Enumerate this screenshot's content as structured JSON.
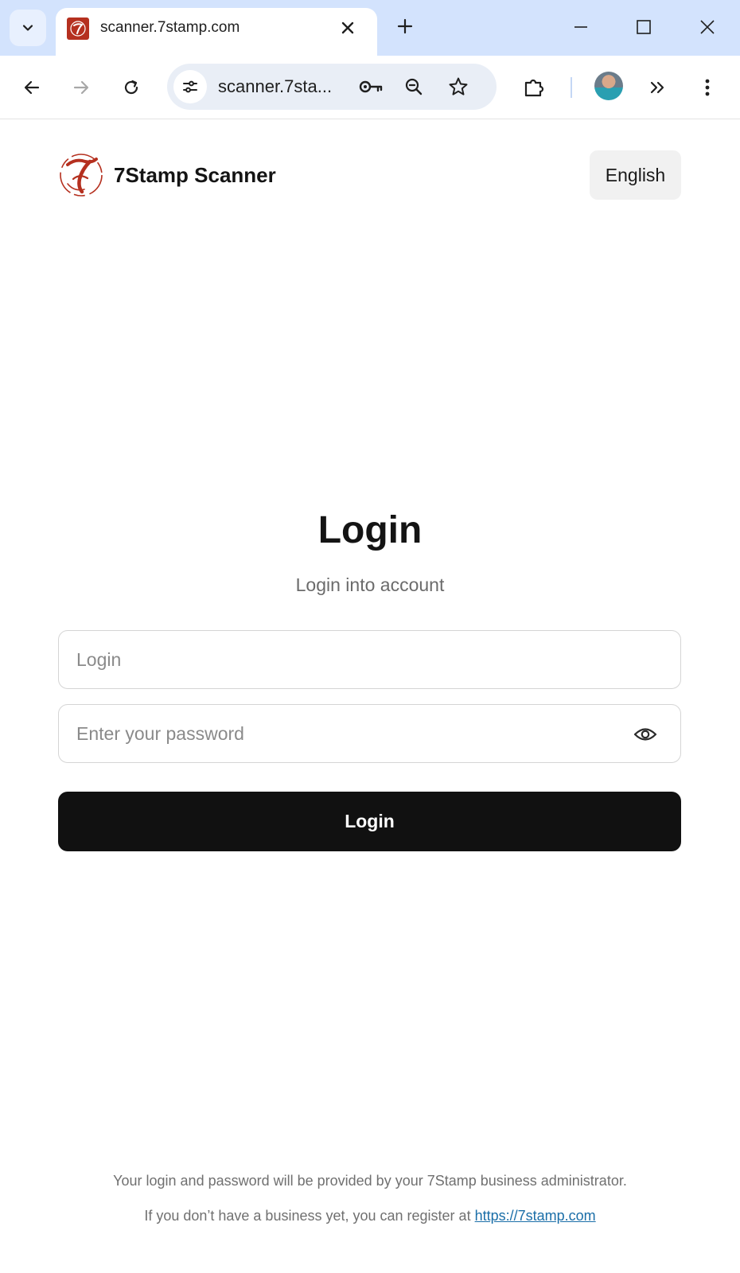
{
  "browser": {
    "tab_title": "scanner.7stamp.com",
    "address": "scanner.7sta...",
    "colors": {
      "tabbar": "#d3e3fd",
      "omnibox": "#e9eef6"
    },
    "icons": {
      "tab_search": "chevron-down-icon",
      "tab_close": "close-icon",
      "new_tab": "plus-icon",
      "minimize": "minimize-icon",
      "maximize": "maximize-icon",
      "close_window": "close-icon",
      "back": "arrow-left-icon",
      "forward": "arrow-right-icon",
      "reload": "reload-icon",
      "site_info": "tune-icon",
      "passwords": "key-icon",
      "zoom": "zoom-out-icon",
      "bookmark": "star-icon",
      "extensions": "puzzle-icon",
      "more_tools": "double-chevron-icon",
      "menu": "kebab-menu-icon"
    }
  },
  "header": {
    "brand_name": "7Stamp Scanner",
    "language_button": "English",
    "logo_color": "#b5301f"
  },
  "login": {
    "title": "Login",
    "subtitle": "Login into account",
    "login_placeholder": "Login",
    "password_placeholder": "Enter your password",
    "submit_label": "Login"
  },
  "footer": {
    "line1": "Your login and password will be provided by your 7Stamp business administrator.",
    "line2_prefix": "If you don’t have a business yet, you can register at",
    "link_text": "https://7stamp.com"
  }
}
